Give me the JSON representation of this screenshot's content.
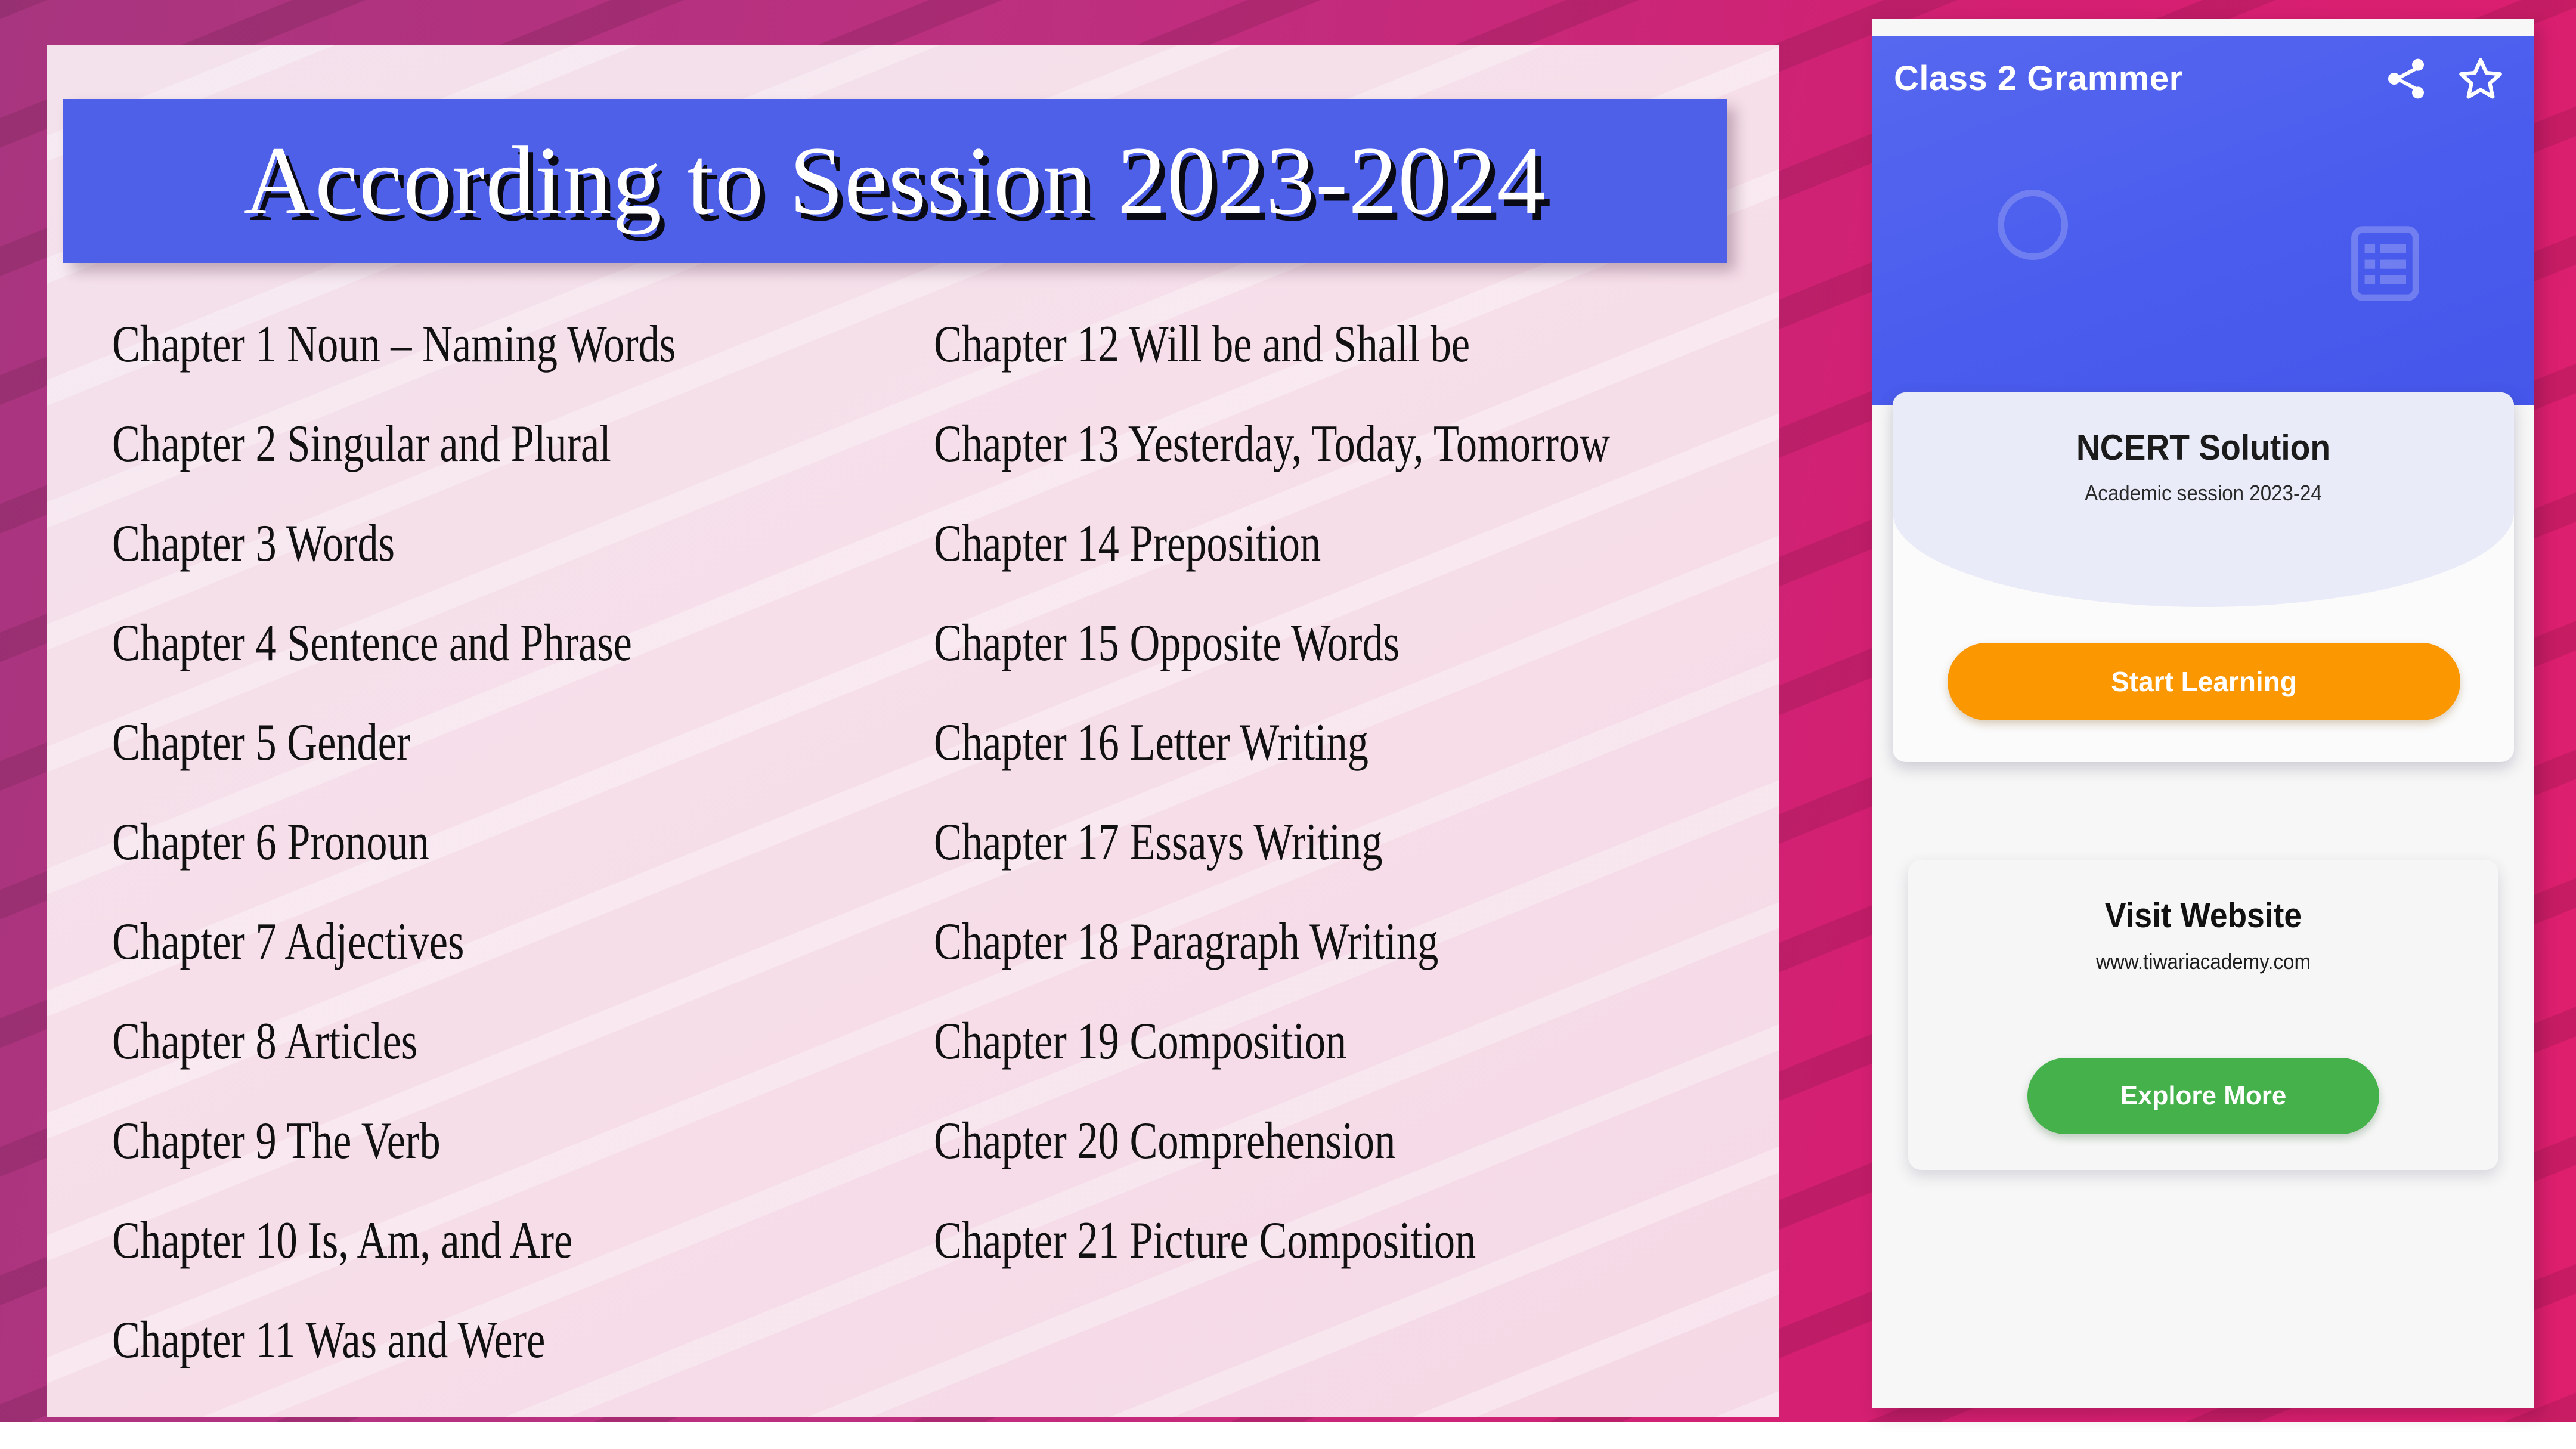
{
  "slide": {
    "title": "According to Session 2023-2024",
    "chapters_left": [
      "Chapter 1 Noun – Naming Words",
      "Chapter 2 Singular and Plural",
      "Chapter 3 Words",
      "Chapter 4 Sentence and Phrase",
      "Chapter 5 Gender",
      "Chapter 6 Pronoun",
      "Chapter 7 Adjectives",
      "Chapter 8 Articles",
      "Chapter 9 The Verb",
      "Chapter 10 Is, Am, and Are",
      "Chapter 11 Was and Were"
    ],
    "chapters_right": [
      "Chapter 12 Will be and Shall be",
      "Chapter 13 Yesterday, Today, Tomorrow",
      "Chapter 14 Preposition",
      "Chapter 15 Opposite Words",
      "Chapter 16 Letter Writing",
      "Chapter 17 Essays Writing",
      "Chapter 18 Paragraph Writing",
      "Chapter 19 Composition",
      "Chapter 20 Comprehension",
      "Chapter 21 Picture Composition"
    ]
  },
  "app": {
    "appbar": {
      "title": "Class 2 Grammer",
      "share_icon": "share-icon",
      "star_icon": "star-outline-icon",
      "decoration_circle": "circle-outline-icon",
      "decoration_list": "list-grid-icon"
    },
    "ncert_card": {
      "title": "NCERT Solution",
      "subtitle": "Academic session 2023-24",
      "button_label": "Start Learning",
      "button_color": "#fb9700"
    },
    "site_card": {
      "title": "Visit Website",
      "url": "www.tiwariacademy.com",
      "button_label": "Explore More",
      "button_color": "#45b14a"
    }
  },
  "colors": {
    "backdrop_start": "#a8357f",
    "backdrop_end": "#de1f6e",
    "slide_bg": "#f5dfe9",
    "title_bar": "#4e60e8",
    "appbar": "#4a5ced",
    "hero": "#e9ecf8"
  }
}
